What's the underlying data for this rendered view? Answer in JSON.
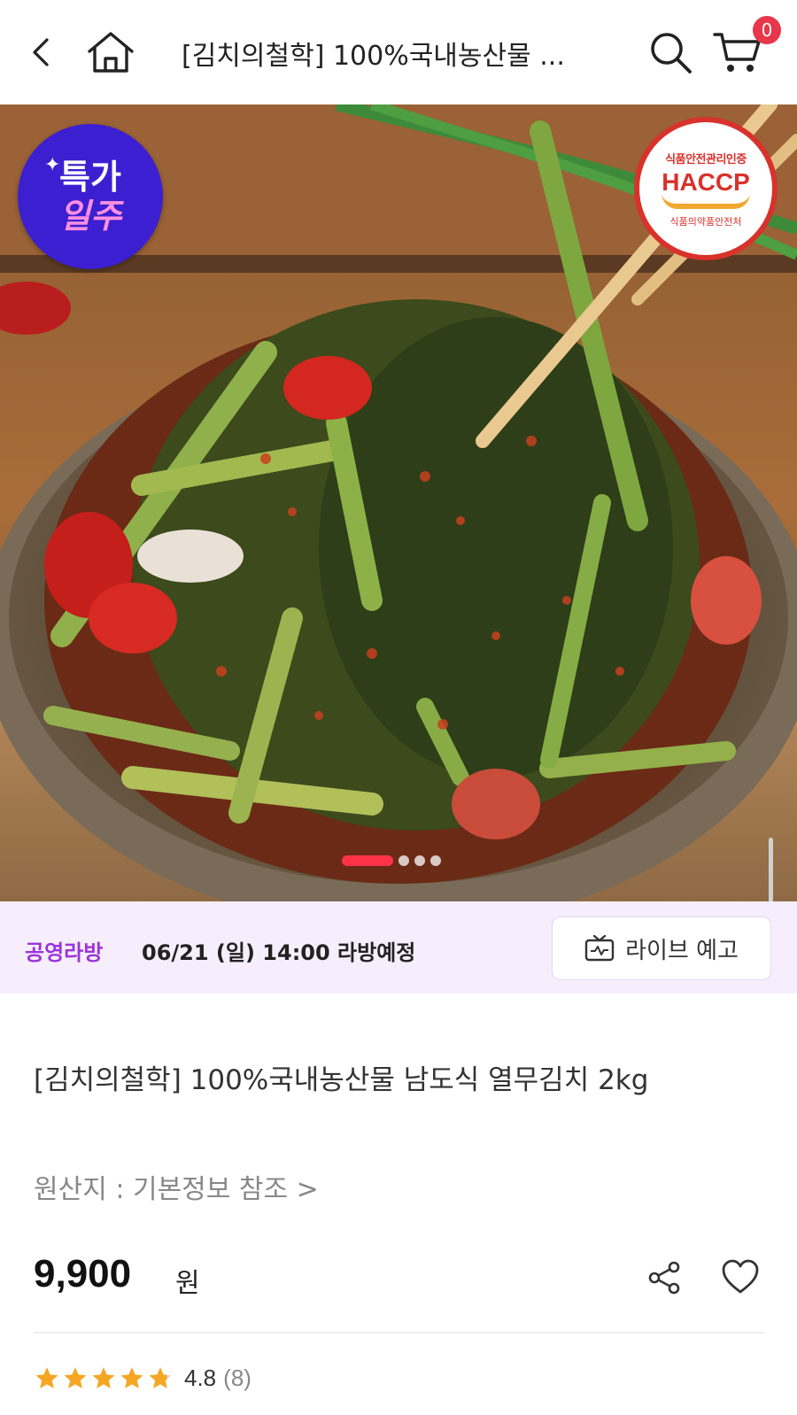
{
  "header": {
    "title": "[김치의철학] 100%국내농산물 ...",
    "cart_count": "0"
  },
  "hero": {
    "promo_badge": {
      "line1": "특가",
      "line2": "일주"
    },
    "haccp_badge": {
      "top": "식품안전관리인증",
      "main": "HACCP",
      "bottom": "식품의약품안전처"
    },
    "carousel": {
      "current_index": 1,
      "total": 4
    }
  },
  "live": {
    "label": "공영라방",
    "schedule": "06/21 (일) 14:00 라방예정",
    "button_label": "라이브 예고"
  },
  "product": {
    "name": "[김치의철학] 100%국내농산물 남도식 열무김치 2kg",
    "origin": "원산지 : 기본정보 참조 >",
    "price": "9,900",
    "price_unit": "원",
    "rating": "4.8",
    "review_count": "(8)",
    "rating_value": 4.8
  },
  "colors": {
    "accent": "#ff3347",
    "live_purple": "#9b35d9",
    "star": "#f5a623",
    "promo_blue": "#3b1fd0",
    "haccp_red": "#d8322b"
  }
}
